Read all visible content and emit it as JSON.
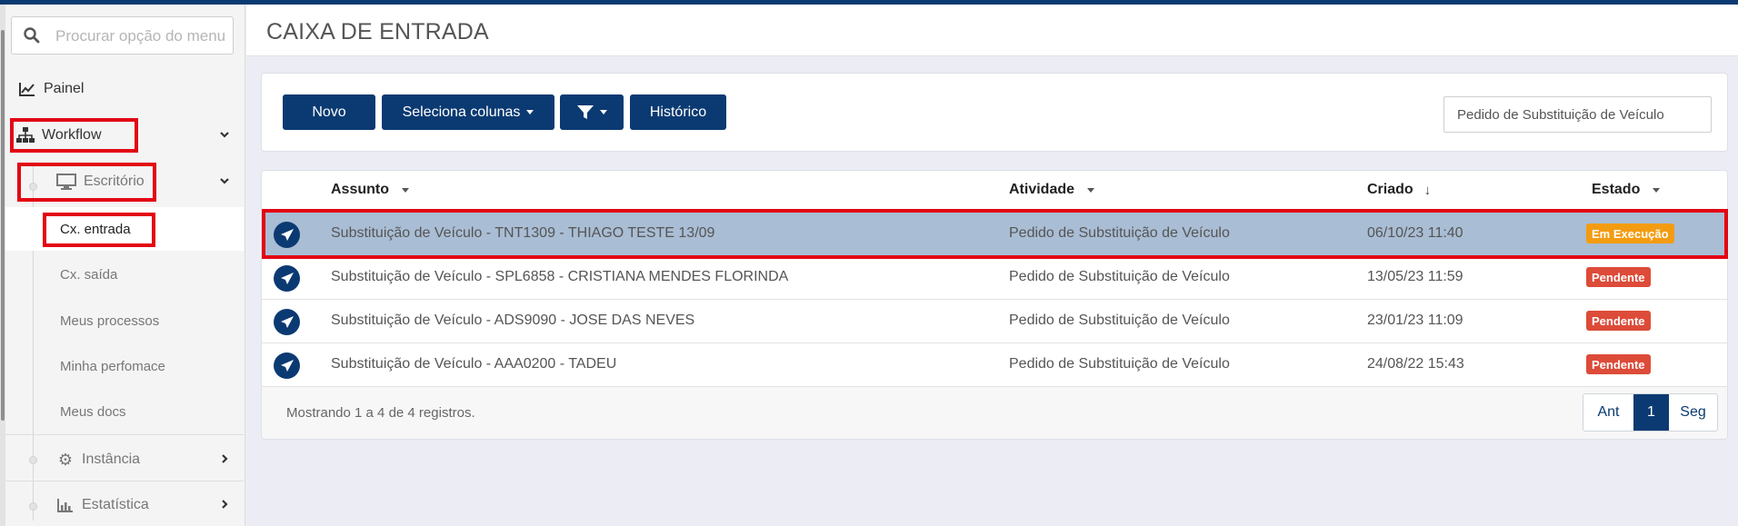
{
  "sidebar": {
    "search_placeholder": "Procurar opção do menu",
    "items": {
      "painel": "Painel",
      "workflow": "Workflow",
      "escritorio": "Escritório",
      "cx_entrada": "Cx. entrada",
      "cx_saida": "Cx. saída",
      "meus_processos": "Meus processos",
      "minha_perfomace": "Minha perfomace",
      "meus_docs": "Meus docs",
      "instancia": "Instância",
      "estatistica": "Estatística"
    }
  },
  "header": {
    "title": "CAIXA DE ENTRADA"
  },
  "toolbar": {
    "novo": "Novo",
    "seleciona_colunas": "Seleciona colunas",
    "historico": "Histórico",
    "filter_value": "Pedido de Substituição de Veículo"
  },
  "table": {
    "columns": {
      "assunto": "Assunto",
      "atividade": "Atividade",
      "criado": "Criado",
      "estado": "Estado"
    },
    "rows": [
      {
        "assunto": "Substituição de Veículo - TNT1309 - THIAGO TESTE 13/09",
        "atividade": "Pedido de Substituição de Veículo",
        "criado": "06/10/23 11:40",
        "estado": "Em Execução"
      },
      {
        "assunto": "Substituição de Veículo - SPL6858 - CRISTIANA MENDES FLORINDA",
        "atividade": "Pedido de Substituição de Veículo",
        "criado": "13/05/23 11:59",
        "estado": "Pendente"
      },
      {
        "assunto": "Substituição de Veículo - ADS9090 - JOSE DAS NEVES",
        "atividade": "Pedido de Substituição de Veículo",
        "criado": "23/01/23 11:09",
        "estado": "Pendente"
      },
      {
        "assunto": "Substituição de Veículo - AAA0200 - TADEU",
        "atividade": "Pedido de Substituição de Veículo",
        "criado": "24/08/22 15:43",
        "estado": "Pendente"
      }
    ],
    "footer_info": "Mostrando 1 a 4 de 4 registros.",
    "pager": {
      "prev": "Ant",
      "current": "1",
      "next": "Seg"
    }
  },
  "colors": {
    "primary": "#0b3a72",
    "selected_row": "#a9bdd4",
    "badge_exec": "#f39c12",
    "badge_pend": "#dd4b39",
    "highlight": "#e30613"
  }
}
